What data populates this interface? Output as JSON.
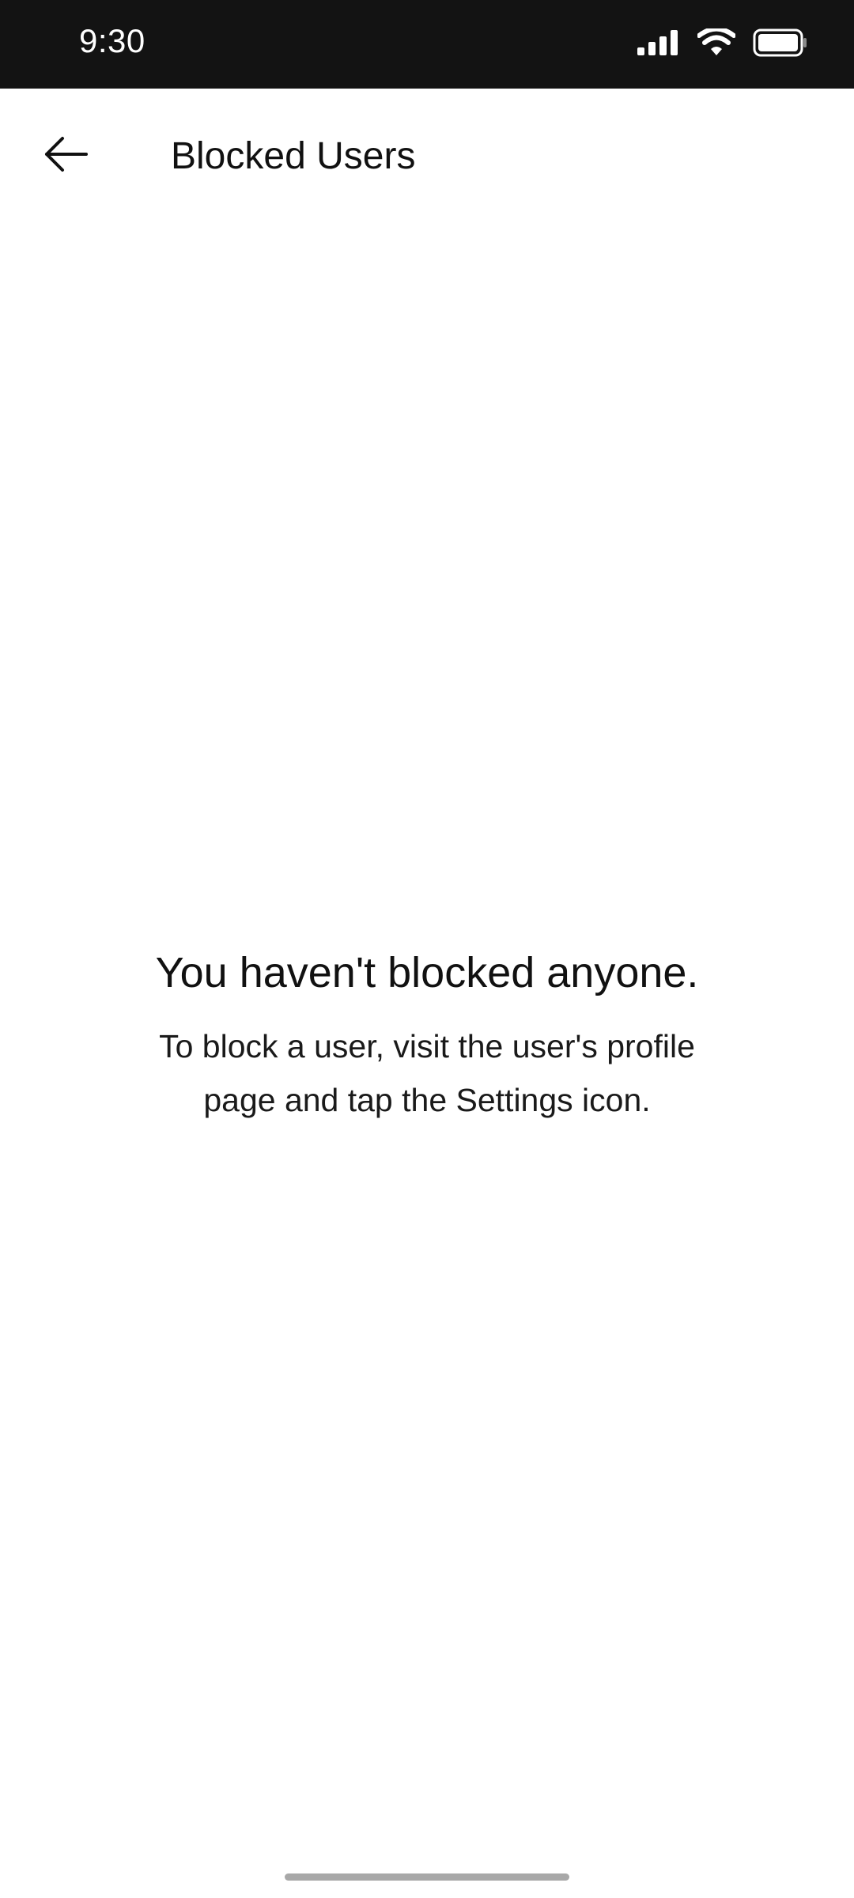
{
  "status_bar": {
    "time": "9:30",
    "icons": [
      "signal-icon",
      "wifi-icon",
      "battery-icon"
    ]
  },
  "header": {
    "back_icon": "arrow-left-icon",
    "title": "Blocked Users"
  },
  "empty_state": {
    "heading": "You haven't blocked anyone.",
    "message": "To block a user, visit the user's profile page and tap the Settings icon."
  },
  "colors": {
    "status_bar_background": "#131313",
    "background": "#ffffff",
    "text": "#111111",
    "home_indicator": "#a8a8a8"
  }
}
